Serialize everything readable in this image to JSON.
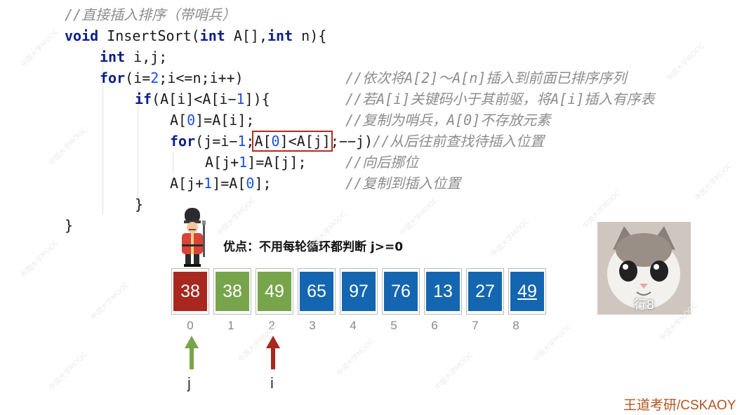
{
  "code": {
    "comment_title": "//直接插入排序（带哨兵）",
    "l1_kw1": "void",
    "l1_text": " InsertSort(",
    "l1_kw2": "int",
    "l1_text2": " A[],",
    "l1_kw3": "int",
    "l1_text3": " n){",
    "l2_kw": "int",
    "l2_text": " i,j;",
    "l3_kw": "for",
    "l3_a": "(i=",
    "l3_n": "2",
    "l3_b": ";i<=n;i++)",
    "l3_cm": "//依次将A[2]～A[n]插入到前面已排序序列",
    "l4_kw": "if",
    "l4_a": "(A[i]<A[i−",
    "l4_n": "1",
    "l4_b": "]){",
    "l4_cm": "//若A[i]关键码小于其前驱，将A[i]插入有序表",
    "l5_a": "A[",
    "l5_n": "0",
    "l5_b": "]=A[i];",
    "l5_cm": "//复制为哨兵，A[0]不存放元素",
    "l6_kw": "for",
    "l6_a": "(j=i−",
    "l6_n": "1",
    "l6_b": ";",
    "l6_hl_a": "A[",
    "l6_hl_n": "0",
    "l6_hl_b": "]<A[j]",
    "l6_c": ";−−j)",
    "l6_cm": "//从后往前查找待插入位置",
    "l7_a": "A[j+",
    "l7_n": "1",
    "l7_b": "]=A[j];",
    "l7_cm": "//向后挪位",
    "l8_a": "A[j+",
    "l8_n": "1",
    "l8_b": "]=A[",
    "l8_n2": "0",
    "l8_c": "];",
    "l8_cm": "//复制到插入位置",
    "l9": "}",
    "l10": "}"
  },
  "note": "优点：不用每轮循环都判断 j>=0",
  "array": {
    "values": [
      "38",
      "38",
      "49",
      "65",
      "97",
      "76",
      "13",
      "27",
      "49"
    ],
    "colors": [
      "#a8281f",
      "#78a54b",
      "#78a54b",
      "#1466b0",
      "#1466b0",
      "#1466b0",
      "#1466b0",
      "#1466b0",
      "#1466b0"
    ],
    "indices": [
      "0",
      "1",
      "2",
      "3",
      "4",
      "5",
      "6",
      "7",
      "8"
    ]
  },
  "pointers": {
    "j_label": "j",
    "i_label": "i",
    "j_color": "#78a54b",
    "i_color": "#a8281f"
  },
  "cat_caption": "行8",
  "brand": "王道考研/CSKAOY",
  "watermark": "中国大学MOOC"
}
